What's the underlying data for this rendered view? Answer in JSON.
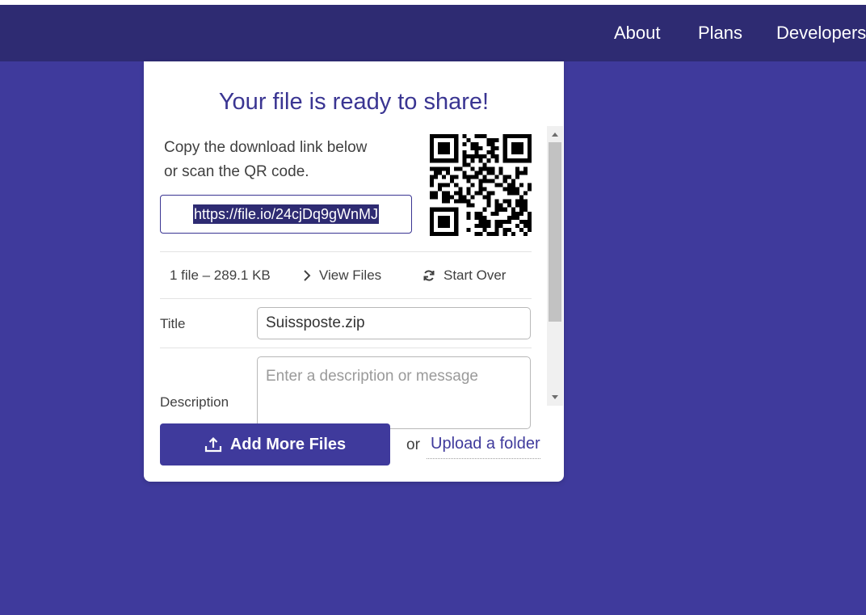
{
  "nav": {
    "links": [
      "About",
      "Plans",
      "Developers"
    ]
  },
  "card": {
    "title": "Your file is ready to share!",
    "instructions_line1": "Copy the download link below",
    "instructions_line2": "or scan the QR code.",
    "download_link": "https://file.io/24cjDq9gWnMJ",
    "file_summary": "1 file – 289.1 KB",
    "view_files_label": "View Files",
    "start_over_label": "Start Over",
    "title_label": "Title",
    "title_value": "Suissposte.zip",
    "description_label": "Description",
    "description_placeholder": "Enter a description or message",
    "add_more_label": "Add More Files",
    "or_text": "or",
    "upload_folder_label": "Upload a folder"
  },
  "icons": {
    "qr": "qr-code",
    "view_files": "chevron-right-icon",
    "start_over": "refresh-icon",
    "add_more": "upload-icon"
  },
  "colors": {
    "background": "#3f3a9c",
    "navbar": "#2e2b72",
    "accent": "#3a3592",
    "card": "#ffffff"
  }
}
